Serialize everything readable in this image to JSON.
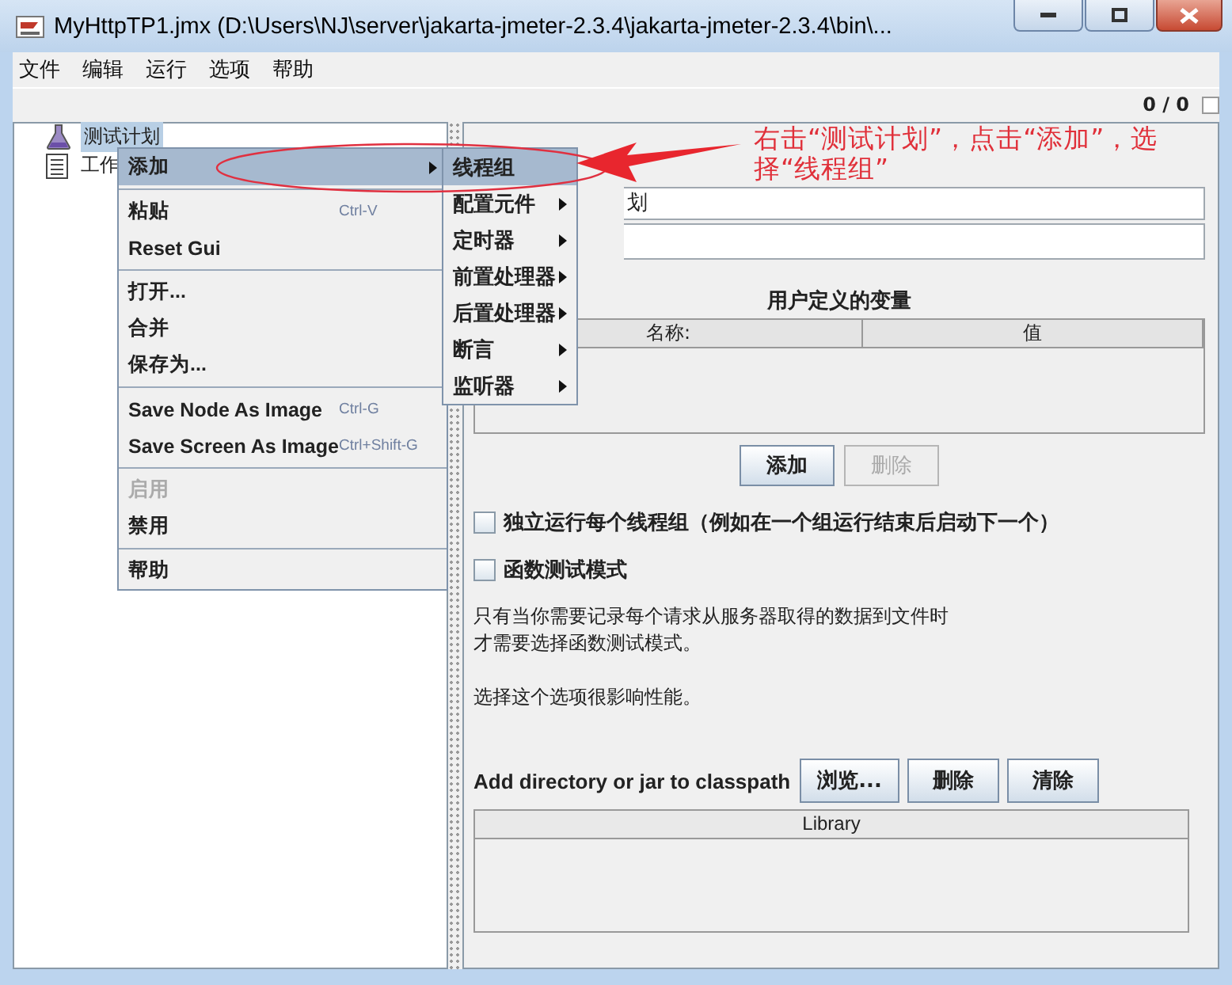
{
  "window": {
    "title": "MyHttpTP1.jmx (D:\\Users\\NJ\\server\\jakarta-jmeter-2.3.4\\jakarta-jmeter-2.3.4\\bin\\..."
  },
  "menu_bar": [
    {
      "label": "文件"
    },
    {
      "label": "编辑"
    },
    {
      "label": "运行"
    },
    {
      "label": "选项"
    },
    {
      "label": "帮助"
    }
  ],
  "toolbar": {
    "thread_count": "0 / 0"
  },
  "tree": [
    {
      "label": "测试计划",
      "selected": true,
      "kind": "plan"
    },
    {
      "label": "工作",
      "selected": false,
      "kind": "workbench"
    }
  ],
  "context_menu": {
    "groups": [
      [
        {
          "label": "添加",
          "selected": true,
          "disabled": false,
          "submenu": true
        }
      ],
      [
        {
          "label": "粘贴",
          "shortcut": "Ctrl-V",
          "selected": false,
          "disabled": false,
          "submenu": false
        },
        {
          "label": "Reset Gui",
          "selected": false,
          "disabled": false,
          "submenu": false
        }
      ],
      [
        {
          "label": "打开...",
          "selected": false,
          "disabled": false,
          "submenu": false
        },
        {
          "label": "合并",
          "selected": false,
          "disabled": false,
          "submenu": false
        },
        {
          "label": "保存为...",
          "selected": false,
          "disabled": false,
          "submenu": false
        }
      ],
      [
        {
          "label": "Save Node As Image",
          "shortcut": "Ctrl-G",
          "selected": false,
          "disabled": false,
          "submenu": false
        },
        {
          "label": "Save Screen As Image",
          "shortcut": "Ctrl+Shift-G",
          "selected": false,
          "disabled": false,
          "submenu": false
        }
      ],
      [
        {
          "label": "启用",
          "selected": false,
          "disabled": true,
          "submenu": false
        },
        {
          "label": "禁用",
          "selected": false,
          "disabled": false,
          "submenu": false
        }
      ],
      [
        {
          "label": "帮助",
          "selected": false,
          "disabled": false,
          "submenu": false
        }
      ]
    ]
  },
  "submenu": [
    {
      "label": "线程组",
      "selected": true,
      "submenu": false
    },
    {
      "label": "配置元件",
      "selected": false,
      "submenu": true
    },
    {
      "label": "定时器",
      "selected": false,
      "submenu": true
    },
    {
      "label": "前置处理器",
      "selected": false,
      "submenu": true
    },
    {
      "label": "后置处理器",
      "selected": false,
      "submenu": true
    },
    {
      "label": "断言",
      "selected": false,
      "submenu": true
    },
    {
      "label": "监听器",
      "selected": false,
      "submenu": true
    }
  ],
  "test_plan": {
    "name_value": "划",
    "variables": {
      "title": "用户定义的变量",
      "columns": [
        "名称:",
        "值"
      ],
      "buttons": [
        {
          "label": "添加",
          "disabled": false
        },
        {
          "label": "删除",
          "disabled": true
        }
      ]
    },
    "options": [
      {
        "label": "独立运行每个线程组（例如在一个组运行结束后启动下一个）",
        "checked": false
      },
      {
        "label": "函数测试模式",
        "checked": false
      }
    ],
    "notes": [
      "只有当你需要记录每个请求从服务器取得的数据到文件时",
      "才需要选择函数测试模式。",
      "选择这个选项很影响性能。"
    ],
    "classpath": {
      "label": "Add directory or jar to classpath",
      "buttons": [
        "浏览...",
        "删除",
        "清除"
      ],
      "column": "Library"
    }
  },
  "annotation": {
    "text": "右击“测试计划”，点击“添加”，选择“线程组”"
  }
}
